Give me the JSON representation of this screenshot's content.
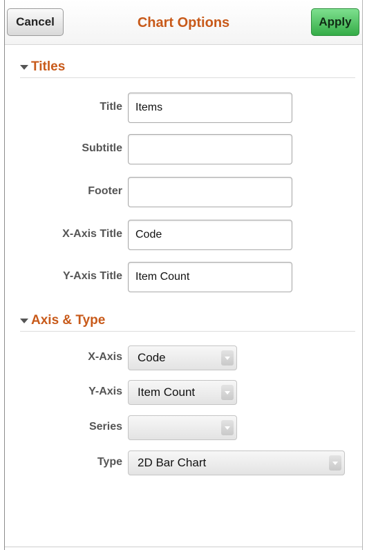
{
  "header": {
    "cancel_label": "Cancel",
    "title": "Chart Options",
    "apply_label": "Apply"
  },
  "sections": {
    "titles": {
      "heading": "Titles",
      "fields": {
        "title": {
          "label": "Title",
          "value": "Items"
        },
        "subtitle": {
          "label": "Subtitle",
          "value": ""
        },
        "footer": {
          "label": "Footer",
          "value": ""
        },
        "x_axis_title": {
          "label": "X-Axis Title",
          "value": "Code"
        },
        "y_axis_title": {
          "label": "Y-Axis Title",
          "value": "Item Count"
        }
      }
    },
    "axis_type": {
      "heading": "Axis & Type",
      "fields": {
        "x_axis": {
          "label": "X-Axis",
          "selected": "Code"
        },
        "y_axis": {
          "label": "Y-Axis",
          "selected": "Item Count"
        },
        "series": {
          "label": "Series",
          "selected": ""
        },
        "type": {
          "label": "Type",
          "selected": "2D Bar Chart"
        }
      }
    }
  },
  "colors": {
    "accent": "#c85a1a",
    "apply_green": "#35ac47"
  },
  "icons": {
    "section_toggle": "triangle-down-icon",
    "dropdown": "chevron-down-icon"
  }
}
